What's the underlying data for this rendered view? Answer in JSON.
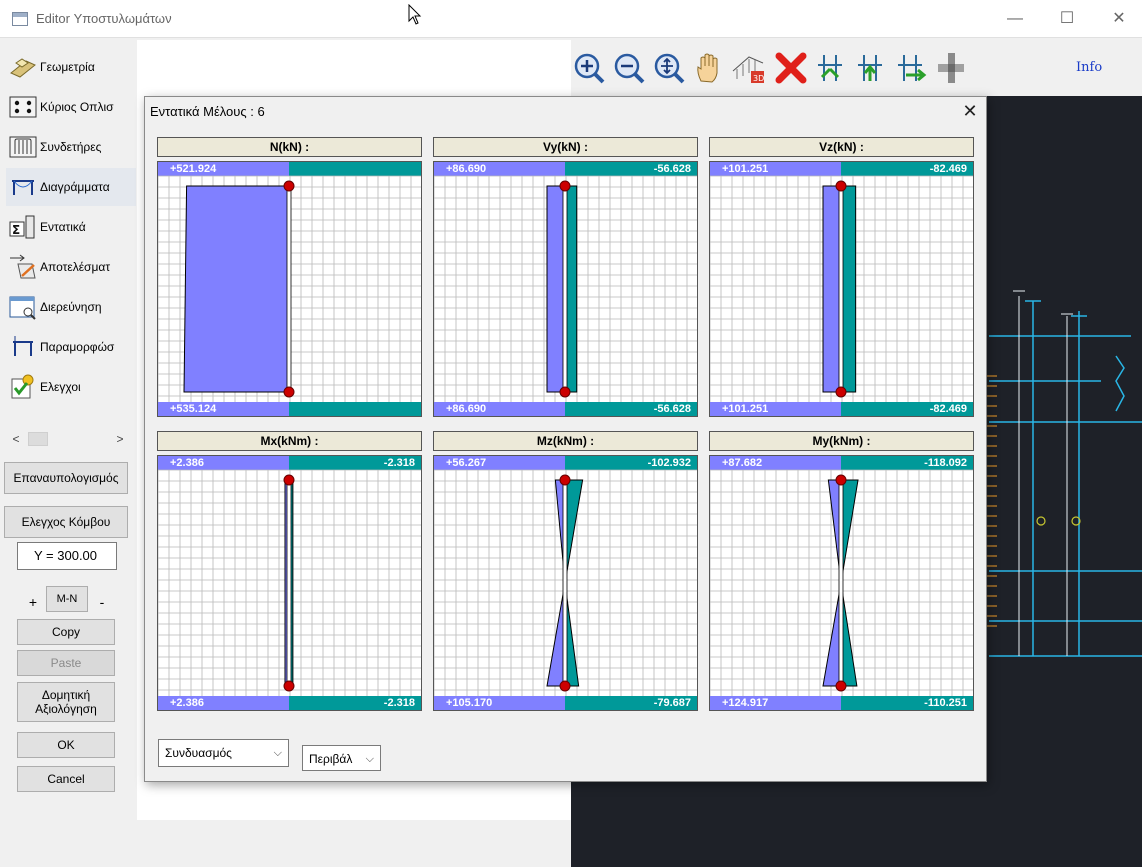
{
  "window": {
    "title": "Editor Υποστυλωμάτων",
    "minimize": "—",
    "maximize": "☐",
    "close": "✕"
  },
  "sidebar": {
    "items": [
      {
        "label": "Γεωμετρία",
        "icon": "geometry-icon"
      },
      {
        "label": "Κύριος Οπλισ",
        "icon": "main-reinforcement-icon"
      },
      {
        "label": "Συνδετήρες",
        "icon": "stirrups-icon"
      },
      {
        "label": "Διαγράμματα",
        "icon": "diagrams-icon"
      },
      {
        "label": "Εντατικά",
        "icon": "internal-forces-icon"
      },
      {
        "label": "Αποτελέσματ",
        "icon": "results-icon"
      },
      {
        "label": "Διερεύνηση",
        "icon": "investigation-icon"
      },
      {
        "label": "Παραμορφώσ",
        "icon": "deformations-icon"
      },
      {
        "label": "Ελεγχοι",
        "icon": "checks-icon"
      }
    ],
    "scroll_left": "<",
    "scroll_right": ">",
    "recalc": "Επαναυπολογισμός",
    "node_check": "Ελεγχος Κόμβου",
    "y_field": "Y = 300.00",
    "plus": "+",
    "mn": "M-N",
    "minus": "-",
    "copy": "Copy",
    "paste": "Paste",
    "structural_eval": "Δομητική Αξιολόγηση",
    "ok": "OK",
    "cancel": "Cancel"
  },
  "toolbar": {
    "tools": [
      "zoom-in-icon",
      "zoom-out-icon",
      "zoom-fit-icon",
      "pan-hand-icon",
      "3d-view-icon",
      "delete-icon",
      "move-icon",
      "up-arrow-icon",
      "right-arrow-icon",
      "joint-icon"
    ],
    "info": "Info"
  },
  "dialog": {
    "title": "Εντατικά Μέλους : 6",
    "close": "✕",
    "colors": {
      "accent_purple": "#8080ff",
      "accent_teal": "#009999",
      "grid": "#b8b8b8",
      "node": "#cc0000"
    },
    "panels": [
      {
        "name": "N",
        "header": "N(kN) :",
        "top_left": "+521.924",
        "top_right": "",
        "bot_left": "+535.124",
        "bot_right": "",
        "top_value_pos": 521.924,
        "bot_value_pos": 535.124,
        "top_value_neg": 0,
        "bot_value_neg": 0
      },
      {
        "name": "Vy",
        "header": "Vy(kN) :",
        "top_left": "+86.690",
        "top_right": "-56.628",
        "bot_left": "+86.690",
        "bot_right": "-56.628",
        "top_value_pos": 86.69,
        "bot_value_pos": 86.69,
        "top_value_neg": 56.628,
        "bot_value_neg": 56.628
      },
      {
        "name": "Vz",
        "header": "Vz(kN) :",
        "top_left": "+101.251",
        "top_right": "-82.469",
        "bot_left": "+101.251",
        "bot_right": "-82.469",
        "top_value_pos": 101.251,
        "bot_value_pos": 101.251,
        "top_value_neg": 82.469,
        "bot_value_neg": 82.469
      },
      {
        "name": "Mx",
        "header": "Mx(kNm) :",
        "top_left": "+2.386",
        "top_right": "-2.318",
        "bot_left": "+2.386",
        "bot_right": "-2.318",
        "top_value_pos": 2.386,
        "bot_value_pos": 2.386,
        "top_value_neg": 2.318,
        "bot_value_neg": 2.318
      },
      {
        "name": "Mz",
        "header": "Mz(kNm) :",
        "top_left": "+56.267",
        "top_right": "-102.932",
        "bot_left": "+105.170",
        "bot_right": "-79.687",
        "top_value_pos": 56.267,
        "bot_value_pos": 105.17,
        "top_value_neg": 102.932,
        "bot_value_neg": 79.687
      },
      {
        "name": "My",
        "header": "My(kNm) :",
        "top_left": "+87.682",
        "top_right": "-118.092",
        "bot_left": "+124.917",
        "bot_right": "-110.251",
        "top_value_pos": 87.682,
        "bot_value_pos": 124.917,
        "top_value_neg": 118.092,
        "bot_value_neg": 110.251
      }
    ],
    "combo_select": "Συνδυασμός",
    "envelope_select": "Περιβάλ"
  }
}
